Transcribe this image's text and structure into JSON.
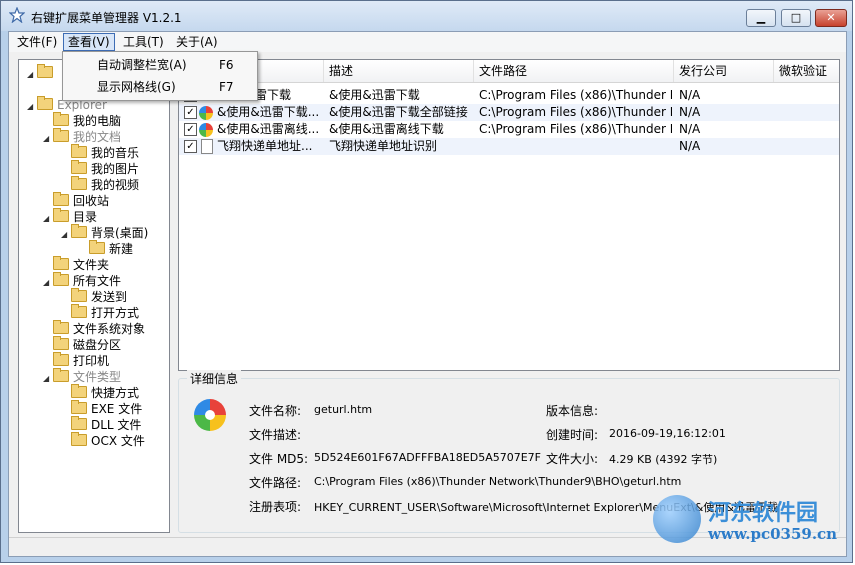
{
  "window": {
    "title": "右键扩展菜单管理器 V1.2.1",
    "buttons": {
      "minimize": "▁",
      "maximize": "□",
      "close": "✕"
    }
  },
  "menubar": {
    "items": [
      {
        "label": "文件(F)"
      },
      {
        "label": "查看(V)"
      },
      {
        "label": "工具(T)"
      },
      {
        "label": "关于(A)"
      }
    ],
    "dropdown": [
      {
        "label": "自动调整栏宽(A)",
        "shortcut": "F6"
      },
      {
        "label": "显示网格线(G)",
        "shortcut": "F7"
      }
    ]
  },
  "tree": {
    "nodes": [
      {
        "label": "Explorer"
      },
      {
        "label": "我的电脑"
      },
      {
        "label": "我的文档"
      },
      {
        "label": "我的音乐"
      },
      {
        "label": "我的图片"
      },
      {
        "label": "我的视频"
      },
      {
        "label": "回收站"
      },
      {
        "label": "目录"
      },
      {
        "label": "背景(桌面)"
      },
      {
        "label": "新建"
      },
      {
        "label": "文件夹"
      },
      {
        "label": "所有文件"
      },
      {
        "label": "发送到"
      },
      {
        "label": "打开方式"
      },
      {
        "label": "文件系统对象"
      },
      {
        "label": "磁盘分区"
      },
      {
        "label": "打印机"
      },
      {
        "label": "文件类型"
      },
      {
        "label": "快捷方式"
      },
      {
        "label": "EXE 文件"
      },
      {
        "label": "DLL 文件"
      },
      {
        "label": "OCX 文件"
      }
    ]
  },
  "list": {
    "columns": [
      "描述",
      "文件路径",
      "发行公司",
      "微软验证"
    ],
    "rows": [
      {
        "name": "迅雷下载",
        "desc": "&使用&迅雷下载",
        "path": "C:\\Program Files (x86)\\Thunder Net...",
        "company": "N/A",
        "verify": ""
      },
      {
        "name": "&使用&迅雷下载...",
        "desc": "&使用&迅雷下载全部链接",
        "path": "C:\\Program Files (x86)\\Thunder Net...",
        "company": "N/A",
        "verify": ""
      },
      {
        "name": "&使用&迅雷离线...",
        "desc": "&使用&迅雷离线下载",
        "path": "C:\\Program Files (x86)\\Thunder Net...",
        "company": "N/A",
        "verify": ""
      },
      {
        "name": "飞翔快递单地址...",
        "desc": "飞翔快递单地址识别",
        "path": "",
        "company": "N/A",
        "verify": ""
      }
    ]
  },
  "details": {
    "title": "详细信息",
    "name_label": "文件名称:",
    "name_value": "geturl.htm",
    "desc_label": "文件描述:",
    "desc_value": "",
    "md5_label": "文件 MD5:",
    "md5_value": "5D524E601F67ADFFFBA18ED5A5707E7F",
    "path_label": "文件路径:",
    "path_value": "C:\\Program Files (x86)\\Thunder Network\\Thunder9\\BHO\\geturl.htm",
    "reg_label": "注册表项:",
    "reg_value": "HKEY_CURRENT_USER\\Software\\Microsoft\\Internet Explorer\\MenuExt\\&使用&迅雷下载",
    "version_label": "版本信息:",
    "version_value": "",
    "created_label": "创建时间:",
    "created_value": "2016-09-19,16:12:01",
    "size_label": "文件大小:",
    "size_value": "4.29 KB (4392 字节)"
  },
  "watermark": {
    "line1": "河东软件园",
    "line2": "www.pc0359.cn"
  }
}
